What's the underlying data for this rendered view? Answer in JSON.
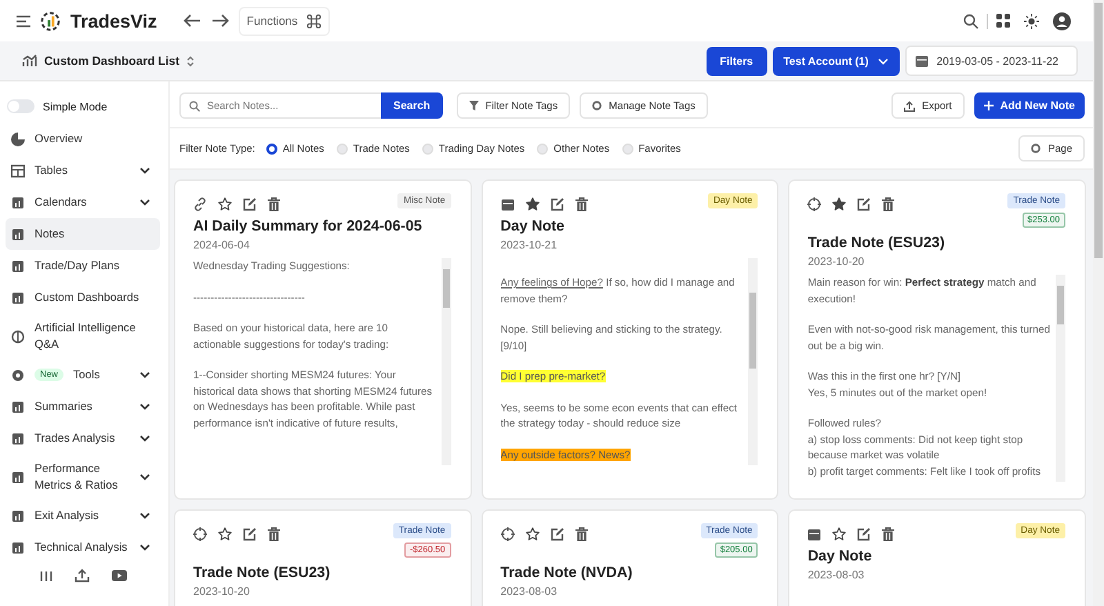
{
  "header": {
    "brand": "TradesViz",
    "functions_label": "Functions"
  },
  "subheader": {
    "title": "Custom Dashboard List",
    "filters_label": "Filters",
    "account": "Test Account (1)",
    "date_range": "2019-03-05 - 2023-11-22"
  },
  "sidebar": {
    "simple_mode": {
      "label": "Simple Mode",
      "on": false
    },
    "items": [
      {
        "label": "Overview",
        "expandable": false,
        "selected": false
      },
      {
        "label": "Tables",
        "expandable": true,
        "selected": false
      },
      {
        "label": "Calendars",
        "expandable": true,
        "selected": false
      },
      {
        "label": "Notes",
        "expandable": false,
        "selected": true
      },
      {
        "label": "Trade/Day Plans",
        "expandable": false,
        "selected": false
      },
      {
        "label": "Custom Dashboards",
        "expandable": false,
        "selected": false
      },
      {
        "label": "Artificial Intelligence Q&A",
        "expandable": false,
        "selected": false
      },
      {
        "label": "Tools",
        "badge": "New",
        "expandable": true,
        "selected": false
      },
      {
        "label": "Summaries",
        "expandable": true,
        "selected": false
      },
      {
        "label": "Trades Analysis",
        "expandable": true,
        "selected": false
      },
      {
        "label": "Performance Metrics & Ratios",
        "expandable": true,
        "selected": false
      },
      {
        "label": "Exit Analysis",
        "expandable": true,
        "selected": false
      },
      {
        "label": "Technical Analysis",
        "expandable": true,
        "selected": false
      }
    ]
  },
  "toolbar": {
    "search": {
      "placeholder": "Search Notes..."
    },
    "search_button": "Search",
    "filter_tags": "Filter Note Tags",
    "manage_tags": "Manage Note Tags",
    "export": "Export",
    "add_note": "Add New Note"
  },
  "filter": {
    "label": "Filter Note Type:",
    "options": [
      {
        "label": "All Notes",
        "selected": true
      },
      {
        "label": "Trade Notes",
        "selected": false
      },
      {
        "label": "Trading Day Notes",
        "selected": false
      },
      {
        "label": "Other Notes",
        "selected": false
      },
      {
        "label": "Favorites",
        "selected": false
      }
    ],
    "page_button": "Page"
  },
  "notes": [
    {
      "kind": "misc",
      "type_label": "Misc Note",
      "favorite": false,
      "title": "AI Daily Summary for 2024-06-05",
      "date": "2024-06-04",
      "body": [
        [
          [
            {
              "text": "Wednesday Trading Suggestions:",
              "kind": "plain"
            }
          ]
        ],
        [
          [
            {
              "text": "--------------------------------",
              "kind": "plain"
            }
          ]
        ],
        [
          [
            {
              "text": "Based on your historical data, here are 10 actionable suggestions for today's trading:",
              "kind": "plain"
            }
          ]
        ],
        [
          [
            {
              "text": "1--Consider shorting MESM24 futures: Your historical data shows that shorting MESM24 futures on Wednesdays has been profitable. While past performance isn't indicative of future results,",
              "kind": "plain"
            }
          ]
        ]
      ]
    },
    {
      "kind": "day",
      "type_label": "Day Note",
      "favorite": true,
      "title": "Day Note",
      "date": "2023-10-21",
      "body": [
        [
          [
            {
              "text": "Any feelings of Hope?",
              "kind": "underlined"
            },
            {
              "text": " If so, how did I manage and remove them?",
              "kind": "plain"
            }
          ]
        ],
        [
          [
            {
              "text": "Nope. Still believing and sticking to the strategy. [9/10]",
              "kind": "plain"
            }
          ]
        ],
        [
          [
            {
              "text": "Did I prep pre-market?",
              "kind": "highlight",
              "color": "#ffff33"
            }
          ]
        ],
        [
          [
            {
              "text": "Yes, seems to be some econ events that can effect the strategy today - should reduce size",
              "kind": "plain"
            }
          ]
        ],
        [
          [
            {
              "text": "Any outside factors? News?",
              "kind": "highlight",
              "color": "#ffa500"
            }
          ]
        ]
      ]
    },
    {
      "kind": "trade",
      "type_label": "Trade Note",
      "pnl": {
        "text": "$253.00",
        "color": "#15803d"
      },
      "favorite": true,
      "title": "Trade Note (ESU23)",
      "date": "2023-10-20",
      "body": [
        [
          [
            {
              "text": "Main reason for win: **Perfect strategy** match and execution!",
              "kind": "plain"
            }
          ]
        ],
        [
          [
            {
              "text": "Even with not-so-good risk management, this turned out be a big win.",
              "kind": "plain"
            }
          ]
        ],
        [
          [
            {
              "text": "Was this in the first one hr? [Y/N]",
              "kind": "plain"
            }
          ],
          [
            {
              "text": "Yes, 5 minutes out of the market open!",
              "kind": "plain"
            }
          ]
        ],
        [
          [
            {
              "text": "Followed rules?",
              "kind": "plain"
            }
          ],
          [
            {
              "text": "a) stop loss comments: Did not keep tight stop because market was volatile",
              "kind": "plain"
            }
          ],
          [
            {
              "text": "b) profit target comments: Felt like I took off profits",
              "kind": "plain"
            }
          ]
        ]
      ]
    },
    {
      "kind": "trade",
      "type_label": "Trade Note",
      "pnl": {
        "text": "-$260.50",
        "color": "#c0262d"
      },
      "favorite": false,
      "title": "Trade Note (ESU23)",
      "date": "2023-10-20"
    },
    {
      "kind": "trade",
      "type_label": "Trade Note",
      "pnl": {
        "text": "$205.00",
        "color": "#15803d"
      },
      "favorite": false,
      "title": "Trade Note (NVDA)",
      "date": "2023-08-03"
    },
    {
      "kind": "day",
      "type_label": "Day Note",
      "favorite": false,
      "title": "Day Note",
      "date": "2023-08-03"
    }
  ]
}
